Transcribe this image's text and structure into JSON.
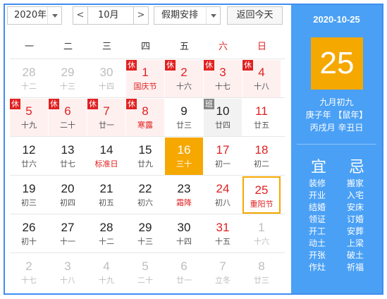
{
  "toolbar": {
    "year": "2020年",
    "prev": "<",
    "month": "10月",
    "next": ">",
    "holiday": "假期安排",
    "today": "返回今天"
  },
  "weekdays": [
    "一",
    "二",
    "三",
    "四",
    "五",
    "六",
    "日"
  ],
  "tags": {
    "rest": "休",
    "work": "班"
  },
  "rows": [
    [
      {
        "d": "28",
        "l": "十二",
        "cls": "other"
      },
      {
        "d": "29",
        "l": "十三",
        "cls": "other"
      },
      {
        "d": "30",
        "l": "十四",
        "cls": "other"
      },
      {
        "d": "1",
        "l": "国庆节",
        "cls": "hol red lred",
        "tag": "rest"
      },
      {
        "d": "2",
        "l": "十六",
        "cls": "hol red",
        "tag": "rest"
      },
      {
        "d": "3",
        "l": "十七",
        "cls": "hol red",
        "tag": "rest"
      },
      {
        "d": "4",
        "l": "十八",
        "cls": "hol red",
        "tag": "rest"
      }
    ],
    [
      {
        "d": "5",
        "l": "十九",
        "cls": "hol red",
        "tag": "rest"
      },
      {
        "d": "6",
        "l": "二十",
        "cls": "hol red",
        "tag": "rest"
      },
      {
        "d": "7",
        "l": "廿一",
        "cls": "hol red",
        "tag": "rest"
      },
      {
        "d": "8",
        "l": "寒露",
        "cls": "hol red lred",
        "tag": "rest"
      },
      {
        "d": "9",
        "l": "廿三",
        "cls": ""
      },
      {
        "d": "10",
        "l": "廿四",
        "cls": "work",
        "tag": "work"
      },
      {
        "d": "11",
        "l": "廿五",
        "cls": "red"
      }
    ],
    [
      {
        "d": "12",
        "l": "廿六",
        "cls": ""
      },
      {
        "d": "13",
        "l": "廿七",
        "cls": ""
      },
      {
        "d": "14",
        "l": "标准日",
        "cls": "lred"
      },
      {
        "d": "15",
        "l": "廿九",
        "cls": ""
      },
      {
        "d": "16",
        "l": "三十",
        "cls": "today"
      },
      {
        "d": "17",
        "l": "初一",
        "cls": "red"
      },
      {
        "d": "18",
        "l": "初二",
        "cls": "red"
      }
    ],
    [
      {
        "d": "19",
        "l": "初三",
        "cls": ""
      },
      {
        "d": "20",
        "l": "初四",
        "cls": ""
      },
      {
        "d": "21",
        "l": "初五",
        "cls": ""
      },
      {
        "d": "22",
        "l": "初六",
        "cls": ""
      },
      {
        "d": "23",
        "l": "霜降",
        "cls": "lred"
      },
      {
        "d": "24",
        "l": "初八",
        "cls": "red"
      },
      {
        "d": "25",
        "l": "重阳节",
        "cls": "red lred sel2"
      }
    ],
    [
      {
        "d": "26",
        "l": "初十",
        "cls": ""
      },
      {
        "d": "27",
        "l": "十一",
        "cls": ""
      },
      {
        "d": "28",
        "l": "十二",
        "cls": ""
      },
      {
        "d": "29",
        "l": "十三",
        "cls": ""
      },
      {
        "d": "30",
        "l": "十四",
        "cls": ""
      },
      {
        "d": "31",
        "l": "十五",
        "cls": "red"
      },
      {
        "d": "1",
        "l": "十六",
        "cls": "other"
      }
    ],
    [
      {
        "d": "2",
        "l": "十七",
        "cls": "other"
      },
      {
        "d": "3",
        "l": "十八",
        "cls": "other"
      },
      {
        "d": "4",
        "l": "十九",
        "cls": "other"
      },
      {
        "d": "5",
        "l": "二十",
        "cls": "other"
      },
      {
        "d": "6",
        "l": "廿一",
        "cls": "other"
      },
      {
        "d": "7",
        "l": "立冬",
        "cls": "other"
      },
      {
        "d": "8",
        "l": "廿三",
        "cls": "other"
      }
    ]
  ],
  "side": {
    "date": "2020-10-25",
    "day": "25",
    "lunar": "九月初九",
    "ganzhi_year": "庚子年 【鼠年】",
    "ganzhi_md": "丙戌月 辛丑日",
    "yi_title": "宜",
    "ji_title": "忌",
    "yi": [
      "装修",
      "开业",
      "结婚",
      "领证",
      "开工",
      "动土",
      "开张",
      "作灶"
    ],
    "ji": [
      "搬家",
      "入宅",
      "安床",
      "订婚",
      "安葬",
      "上梁",
      "破土",
      "祈福"
    ]
  },
  "colors": {
    "accent": "#4aa0f5",
    "today": "#f5a800",
    "holiday_red": "#e02020",
    "holiday_bg": "#fff0f0"
  }
}
